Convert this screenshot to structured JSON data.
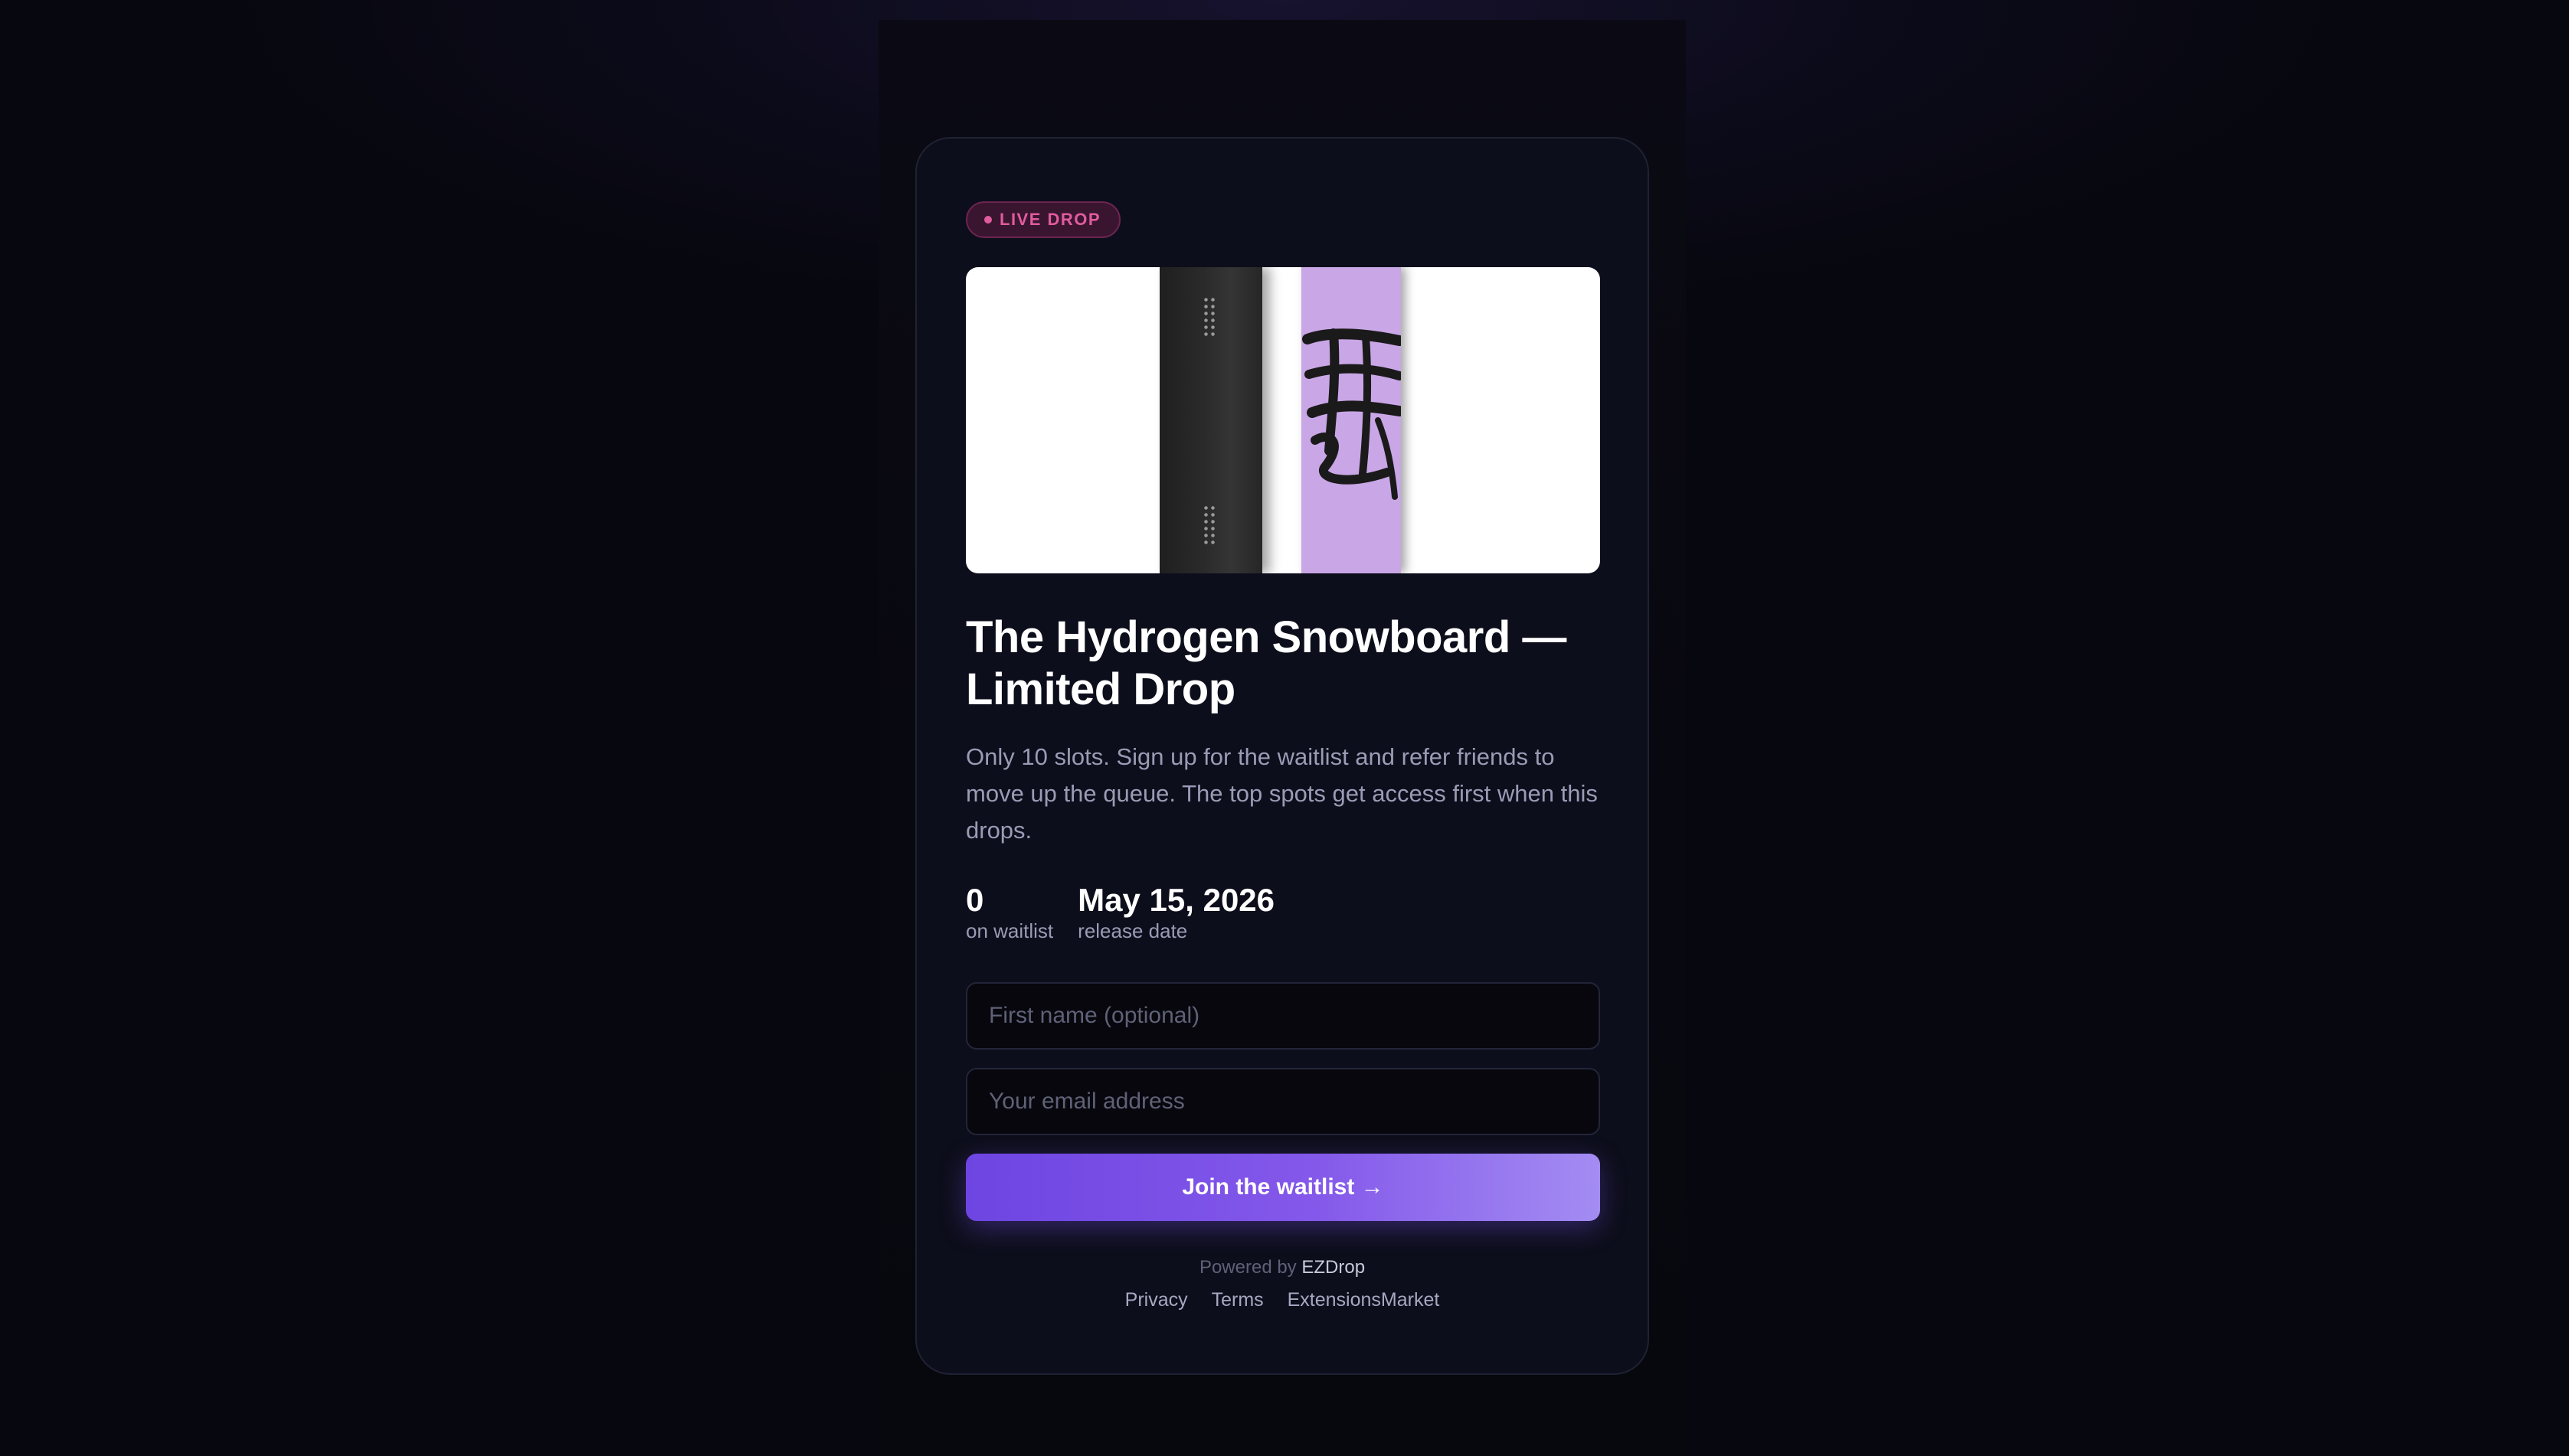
{
  "badge": {
    "label": "LIVE DROP"
  },
  "product": {
    "title": "The Hydrogen Snowboard — Limited Drop",
    "description": "Only 10 slots. Sign up for the waitlist and refer friends to move up the queue. The top spots get access first when this drops."
  },
  "stats": {
    "waitlist_count": "0",
    "waitlist_label": "on waitlist",
    "release_date": "May 15, 2026",
    "release_label": "release date"
  },
  "form": {
    "first_name_placeholder": "First name (optional)",
    "first_name_value": "",
    "email_placeholder": "Your email address",
    "email_value": "",
    "submit_label": "Join the waitlist →"
  },
  "footer": {
    "powered_prefix": "Powered by",
    "powered_brand": "EZDrop",
    "links": [
      "Privacy",
      "Terms",
      "ExtensionsMarket"
    ]
  },
  "colors": {
    "accent_start": "#6e45e2",
    "accent_end": "#a38cf2",
    "badge_pink": "#e05c9e",
    "card_bg": "#0d0e1b",
    "page_bg": "#0c0b1a"
  }
}
